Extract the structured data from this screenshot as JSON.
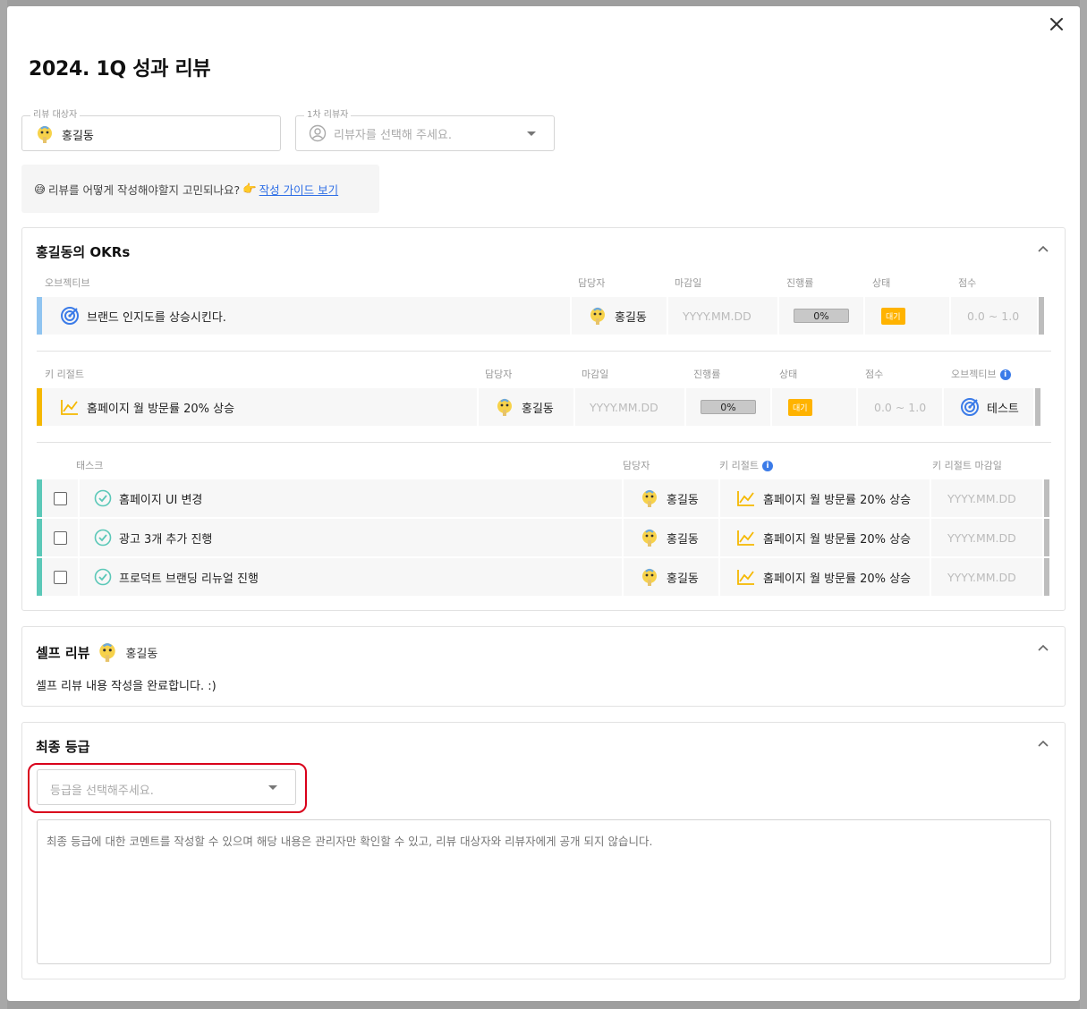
{
  "modal": {
    "title": "2024. 1Q 성과 리뷰"
  },
  "reviewee": {
    "legend": "리뷰 대상자",
    "value": "홍길동"
  },
  "reviewer": {
    "legend": "1차 리뷰자",
    "placeholder": "리뷰자를 선택해 주세요."
  },
  "guide": {
    "emoji_start": "😅",
    "text": "리뷰를 어떻게 작성해야할지 고민되나요?",
    "emoji_point": "👉",
    "link": "작성 가이드 보기"
  },
  "okr": {
    "title": "홍길동의 OKRs",
    "objective_headers": [
      "오브젝티브",
      "담당자",
      "마감일",
      "진행률",
      "상태",
      "점수"
    ],
    "objective": {
      "title": "브랜드 인지도를 상승시킨다.",
      "owner": "홍길동",
      "due": "YYYY.MM.DD",
      "progress": "0%",
      "status": "대기",
      "score": "0.0 ~ 1.0"
    },
    "kr_headers": [
      "키 리절트",
      "담당자",
      "마감일",
      "진행률",
      "상태",
      "점수",
      "오브젝티브"
    ],
    "key_result": {
      "title": "홈페이지 월 방문률 20% 상승",
      "owner": "홍길동",
      "due": "YYYY.MM.DD",
      "progress": "0%",
      "status": "대기",
      "score": "0.0 ~ 1.0",
      "objective": "테스트"
    },
    "task_headers": [
      "태스크",
      "담당자",
      "키 리절트",
      "키 리절트 마감일"
    ],
    "tasks": [
      {
        "title": "홈페이지 UI 변경",
        "owner": "홍길동",
        "kr": "홈페이지 월 방문률 20% 상승",
        "due": "YYYY.MM.DD"
      },
      {
        "title": "광고 3개 추가 진행",
        "owner": "홍길동",
        "kr": "홈페이지 월 방문률 20% 상승",
        "due": "YYYY.MM.DD"
      },
      {
        "title": "프로덕트 브랜딩 리뉴얼 진행",
        "owner": "홍길동",
        "kr": "홈페이지 월 방문률 20% 상승",
        "due": "YYYY.MM.DD"
      }
    ]
  },
  "self_review": {
    "title": "셀프 리뷰",
    "author": "홍길동",
    "content": "셀프 리뷰 내용 작성을 완료합니다. :)"
  },
  "final_grade": {
    "title": "최종 등급",
    "placeholder": "등급을 선택해주세요.",
    "comment_placeholder": "최종 등급에 대한 코멘트를 작성할 수 있으며 해당 내용은 관리자만 확인할 수 있고, 리뷰 대상자와 리뷰자에게 공개 되지 않습니다."
  },
  "colors": {
    "objective_accent": "#90c4f0",
    "kr_accent": "#f5b800",
    "task_accent": "#5bc8b8",
    "status_badge": "#ffb300",
    "link": "#2e6ee6",
    "highlight": "#d9001b"
  }
}
